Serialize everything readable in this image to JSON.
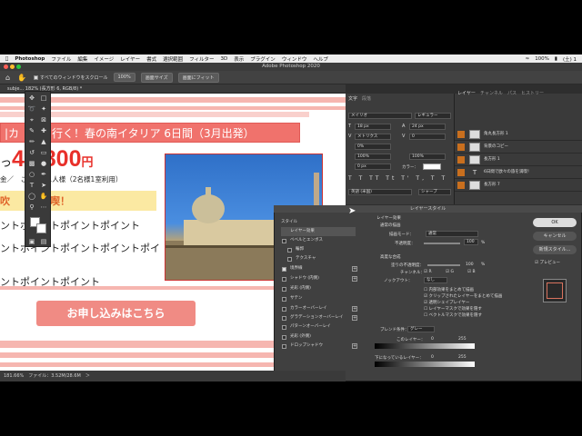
{
  "menubar": {
    "app": "Photoshop",
    "items": [
      "ファイル",
      "編集",
      "イメージ",
      "レイヤー",
      "書式",
      "選択範囲",
      "フィルター",
      "3D",
      "表示",
      "プラグイン",
      "ウィンドウ",
      "ヘルプ"
    ],
    "battery": "100%",
    "clock": "(土) 1"
  },
  "window": {
    "title": "Adobe Photoshop 2020"
  },
  "options": {
    "scroll_all_label": "すべてのウィンドウをスクロール",
    "zoom": "100%",
    "fit_screen": "画面サイズ",
    "fill_screen": "画面にフィット"
  },
  "doc": {
    "tab": "subje... 182% (長方形 6, RGB/8) *"
  },
  "canvas": {
    "headline": "|カ　島も行く！春の南イタリア 6日間（3月出発）",
    "price_prefix": "っ",
    "price": "49,800",
    "yen": "円",
    "sub": "金／　こどもお1人様（2名様1室利用）",
    "yellow": "吹　　大満喫！",
    "points": [
      "ントポイントポイントポイント",
      "ントポイントポイントポイントポイ",
      "ントポイントポイント"
    ],
    "apply": "お申し込みはこちら"
  },
  "char_panel": {
    "tabs": [
      "文字",
      "段落"
    ],
    "font": "メイリオ",
    "style": "レギュラー",
    "size": "18 px",
    "leading": "24 px",
    "kerning": "メトリクス",
    "tracking": "0",
    "percent": "0%",
    "vscale": "100%",
    "hscale": "100%",
    "baseline": "0 px",
    "color_label": "カラー：",
    "lang": "英語 (米国)",
    "aa": "シャープ"
  },
  "layers_panel": {
    "tabs": [
      "レイヤー",
      "チャンネル",
      "パス",
      "ヒストリー"
    ],
    "layers": [
      "角丸長方形 1",
      "背景のコピー",
      "長方形 1",
      "6日間で欧々の旅を満喫！",
      "長方形 7"
    ]
  },
  "dialog": {
    "title": "レイヤースタイル",
    "styles_label": "スタイル",
    "items": [
      {
        "label": "レイヤー効果",
        "checked": false,
        "plus": false
      },
      {
        "label": "ベベルとエンボス",
        "checked": false,
        "plus": false
      },
      {
        "label": "輪郭",
        "checked": false,
        "plus": false
      },
      {
        "label": "テクスチャ",
        "checked": false,
        "plus": false
      },
      {
        "label": "境界線",
        "checked": true,
        "plus": true
      },
      {
        "label": "シャドウ (内側)",
        "checked": false,
        "plus": true
      },
      {
        "label": "光彩 (内側)",
        "checked": false,
        "plus": false
      },
      {
        "label": "サテン",
        "checked": false,
        "plus": false
      },
      {
        "label": "カラーオーバーレイ",
        "checked": false,
        "plus": true
      },
      {
        "label": "グラデーションオーバーレイ",
        "checked": false,
        "plus": true
      },
      {
        "label": "パターンオーバーレイ",
        "checked": false,
        "plus": false
      },
      {
        "label": "光彩 (外側)",
        "checked": false,
        "plus": false
      },
      {
        "label": "ドロップシャドウ",
        "checked": false,
        "plus": true
      }
    ],
    "blend_header": "レイヤー効果",
    "general_blend": "通常の描画",
    "blend_mode_label": "描画モード：",
    "blend_mode": "通常",
    "opacity_label": "不透明度：",
    "opacity": "100",
    "advanced": "高度な合成",
    "fill_opacity_label": "塗りの不透明度：",
    "fill_opacity": "100",
    "channels_label": "チャンネル：",
    "channels": [
      "R",
      "G",
      "B"
    ],
    "knockout_label": "ノックアウト：",
    "knockout": "なし",
    "options": [
      {
        "label": "内部効果をまとめて描画",
        "checked": false
      },
      {
        "label": "クリップされたレイヤーをまとめて描画",
        "checked": true
      },
      {
        "label": "透明シェイプレイヤー",
        "checked": true
      },
      {
        "label": "レイヤーマスクで効果を隠す",
        "checked": false
      },
      {
        "label": "ベクトルマスクで効果を隠す",
        "checked": false
      }
    ],
    "blend_if_label": "ブレンド条件：",
    "blend_if": "グレー",
    "this_layer_label": "このレイヤー：",
    "this_layer_min": "0",
    "this_layer_max": "255",
    "under_layer_label": "下になっているレイヤー：",
    "under_min": "0",
    "under_max": "255",
    "ok": "OK",
    "cancel": "キャンセル",
    "new_style": "新規スタイル...",
    "preview": "プレビュー"
  },
  "status": {
    "text": "181.66%　ファイル：3.52M/28.6M　＞"
  }
}
